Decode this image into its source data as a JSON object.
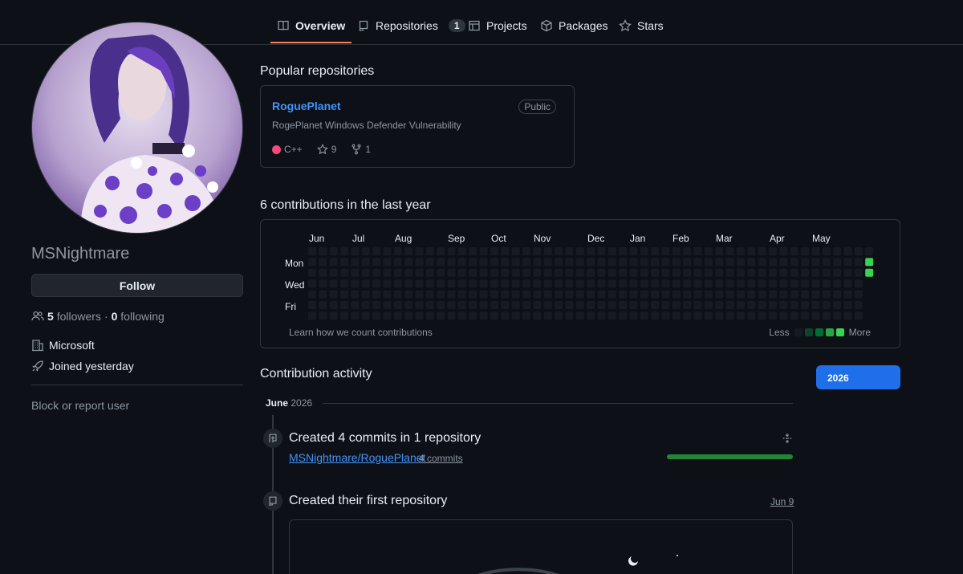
{
  "nav": {
    "tabs": [
      {
        "label": "Overview",
        "icon": "book-icon",
        "active": true
      },
      {
        "label": "Repositories",
        "icon": "repo-icon",
        "count": "1"
      },
      {
        "label": "Projects",
        "icon": "table-icon"
      },
      {
        "label": "Packages",
        "icon": "package-icon"
      },
      {
        "label": "Stars",
        "icon": "star-icon"
      }
    ]
  },
  "profile": {
    "username": "MSNightmare",
    "follow_label": "Follow",
    "followers_count": "5",
    "followers_label": "followers",
    "following_count": "0",
    "following_label": "following",
    "dot": "·",
    "company": "Microsoft",
    "joined": "Joined yesterday",
    "block_label": "Block or report user"
  },
  "popular": {
    "heading": "Popular repositories",
    "repo": {
      "name": "RoguePlanet",
      "visibility": "Public",
      "description": "RogePlanet Windows Defender Vulnerability",
      "language": "C++",
      "language_color": "#f34b7d",
      "stars": "9",
      "forks": "1"
    }
  },
  "contributions": {
    "heading": "6 contributions in the last year",
    "months": [
      "Jun",
      "Jul",
      "Aug",
      "Sep",
      "Oct",
      "Nov",
      "Dec",
      "Jan",
      "Feb",
      "Mar",
      "Apr",
      "May"
    ],
    "days": [
      "Mon",
      "Wed",
      "Fri"
    ],
    "learn_label": "Learn how we count contributions",
    "less_label": "Less",
    "more_label": "More",
    "colors": {
      "empty": "#161b22",
      "l1": "#0e4429",
      "l2": "#006d32",
      "l3": "#26a641",
      "l4": "#39d353"
    }
  },
  "activity": {
    "heading": "Contribution activity",
    "year_button": "2026",
    "month_label": "June",
    "year_label": "2026",
    "commits_title": "Created 4 commits in 1 repository",
    "commits_repo": "MSNightmare/RoguePlanet",
    "commits_count": "4 commits",
    "commits_share": 1.0,
    "first_repo_title": "Created their first repository",
    "first_repo_date": "Jun 9"
  }
}
